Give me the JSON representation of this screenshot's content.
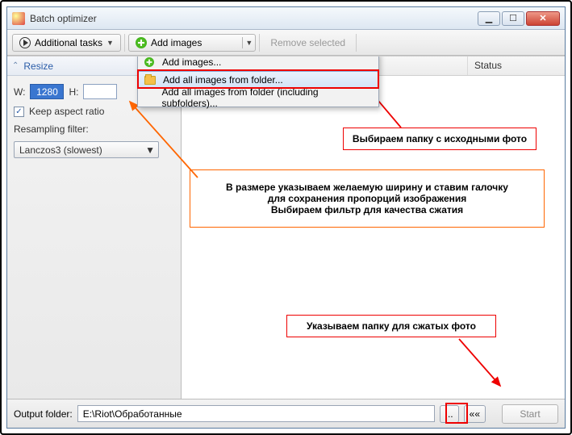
{
  "window": {
    "title": "Batch optimizer"
  },
  "toolbar": {
    "additional_tasks": "Additional tasks",
    "add_images": "Add images",
    "remove_selected": "Remove selected"
  },
  "menu": {
    "items": [
      {
        "label": "Add images..."
      },
      {
        "label": "Add all images from folder..."
      },
      {
        "label": "Add all images from folder (including subfolders)..."
      }
    ]
  },
  "sidebar": {
    "resize_header": "Resize",
    "w_label": "W:",
    "w_value": "1280",
    "h_label": "H:",
    "h_value": "",
    "keep_aspect": "Keep aspect ratio",
    "filter_label": "Resampling filter:",
    "filter_value": "Lanczos3 (slowest)"
  },
  "list": {
    "col_name": "",
    "col_status": "Status"
  },
  "footer": {
    "label": "Output folder:",
    "path": "E:\\Riot\\Обработанные",
    "browse": "...",
    "back": "««",
    "start": "Start"
  },
  "annotations": {
    "a1": "Выбираем папку с исходными фото",
    "a2_line1": "В размере указываем желаемую ширину и ставим галочку",
    "a2_line2": "для сохранения пропорций изображения",
    "a2_line3": "Выбираем фильтр для качества сжатия",
    "a3": "Указываем папку для сжатых фото"
  }
}
